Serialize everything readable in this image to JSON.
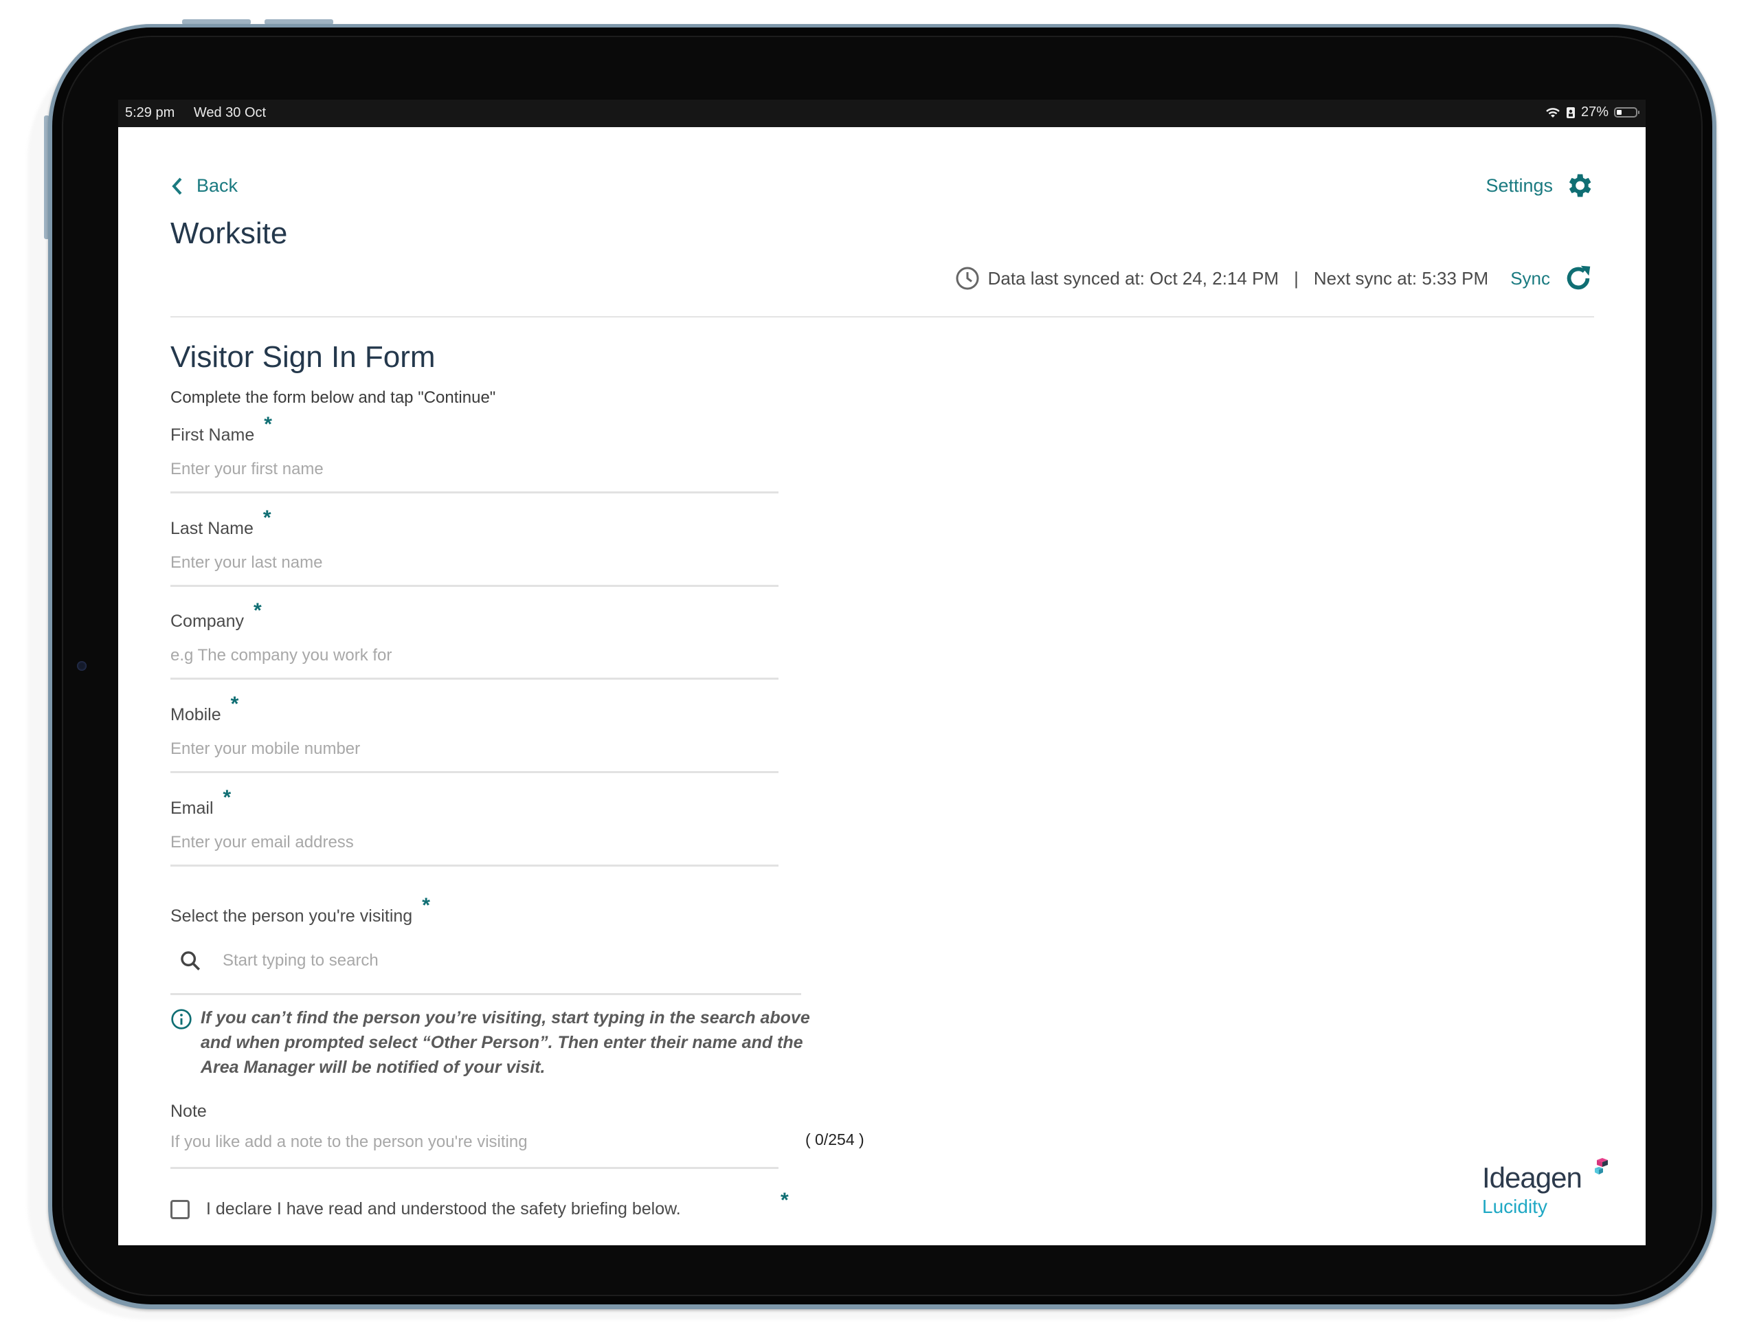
{
  "status_bar": {
    "time": "5:29 pm",
    "date": "Wed 30 Oct",
    "battery_percent": "27%",
    "battery_level": 0.27,
    "icons": [
      "wifi-icon",
      "sim-icon",
      "battery-icon"
    ]
  },
  "header": {
    "back_label": "Back",
    "page_title": "Worksite",
    "settings_label": "Settings",
    "sync_info": {
      "last_synced": "Data last synced at: Oct 24, 2:14 PM",
      "separator": "|",
      "next_sync": "Next sync at: 5:33 PM"
    },
    "sync_label": "Sync"
  },
  "form": {
    "title": "Visitor Sign In Form",
    "subtitle": "Complete the form below and tap \"Continue\"",
    "required_marker": "*",
    "fields": [
      {
        "label": "First Name",
        "placeholder": "Enter your first name",
        "value": "",
        "required": true
      },
      {
        "label": "Last Name",
        "placeholder": "Enter your last name",
        "value": "",
        "required": true
      },
      {
        "label": "Company",
        "placeholder": "e.g The company you work for",
        "value": "",
        "required": true
      },
      {
        "label": "Mobile",
        "placeholder": "Enter your mobile number",
        "value": "",
        "required": true
      },
      {
        "label": "Email",
        "placeholder": "Enter your email address",
        "value": "",
        "required": true
      }
    ],
    "person_search": {
      "label": "Select the person you're visiting",
      "placeholder": "Start typing to search",
      "value": "",
      "required": true
    },
    "info_text": "If you can’t find the person you’re visiting, start typing in the search above and when prompted select “Other Person”. Then enter their name and the Area Manager will be notified of your visit.",
    "note": {
      "label": "Note",
      "placeholder": "If you like add a note to the person you're visiting",
      "value": "",
      "counter": "( 0/254 )"
    },
    "declaration": {
      "label": "I declare I have read and understood the safety briefing below.",
      "checked": false,
      "required": true
    }
  },
  "branding": {
    "company": "Ideagen",
    "product": "Lucidity"
  },
  "colors": {
    "accent": "#1a7a80",
    "title": "#24384c",
    "placeholder": "#a8a8a8",
    "brand_product": "#1fa8c4"
  }
}
